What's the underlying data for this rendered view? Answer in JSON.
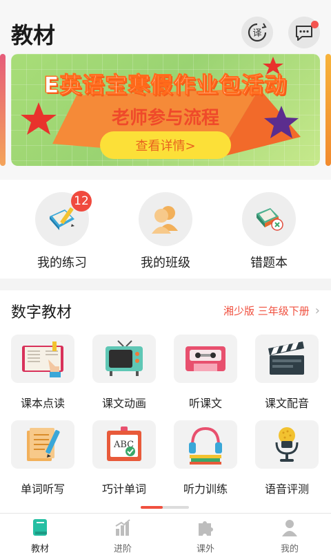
{
  "header": {
    "title": "教材"
  },
  "banner": {
    "title": "E英语宝寒假作业包活动",
    "subtitle": "老师参与流程",
    "button_label": "查看详情>"
  },
  "quick_actions": [
    {
      "label": "我的练习",
      "badge": "12",
      "icon": "book-pencil-icon"
    },
    {
      "label": "我的班级",
      "icon": "classmates-icon"
    },
    {
      "label": "错题本",
      "icon": "wrong-book-icon"
    }
  ],
  "digital": {
    "title": "数字教材",
    "edition": "湘少版 三年级下册",
    "tiles": [
      {
        "label": "课本点读",
        "icon": "textbook-read-icon"
      },
      {
        "label": "课文动画",
        "icon": "tv-icon"
      },
      {
        "label": "听课文",
        "icon": "cassette-icon"
      },
      {
        "label": "课文配音",
        "icon": "clapperboard-icon"
      },
      {
        "label": "单词听写",
        "icon": "dictation-icon"
      },
      {
        "label": "巧计单词",
        "icon": "abc-board-icon"
      },
      {
        "label": "听力训练",
        "icon": "headphones-icon"
      },
      {
        "label": "语音评测",
        "icon": "microphone-icon"
      }
    ],
    "pager_progress": 0.45
  },
  "nav": [
    {
      "label": "教材",
      "icon": "textbook-icon",
      "active": true
    },
    {
      "label": "进阶",
      "icon": "bar-chart-icon"
    },
    {
      "label": "课外",
      "icon": "puzzle-icon"
    },
    {
      "label": "我的",
      "icon": "person-icon"
    }
  ],
  "colors": {
    "accent": "#f0503f",
    "nav_active": "#25bfa3"
  }
}
